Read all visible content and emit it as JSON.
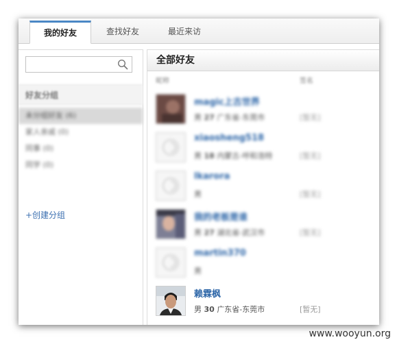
{
  "tabs": [
    {
      "label": "我的好友",
      "active": true
    },
    {
      "label": "查找好友",
      "active": false
    },
    {
      "label": "最近来访",
      "active": false
    }
  ],
  "sidebar": {
    "search": {
      "placeholder": "",
      "value": ""
    },
    "group_header": "好友分组",
    "groups": [
      {
        "label": "未分组好友 (6)"
      },
      {
        "label": "家人亲戚 (0)"
      },
      {
        "label": "同事 (0)"
      },
      {
        "label": "同学 (0)"
      }
    ],
    "create_group": "+创建分组"
  },
  "main": {
    "title": "全部好友",
    "columns": {
      "name": "昵称",
      "status": "签名"
    },
    "friends": [
      {
        "name": "magic上古世界",
        "gender": "男",
        "age": "27",
        "location": "广东省-东莞市",
        "status": "[暂无]",
        "avatar": "photo-dark"
      },
      {
        "name": "xiaosheng518",
        "gender": "男",
        "age": "18",
        "location": "内蒙古-呼和浩特",
        "status": "[暂无]",
        "avatar": "default"
      },
      {
        "name": "lkarora",
        "gender": "男",
        "age": "",
        "location": "",
        "status": "[暂无]",
        "avatar": "default"
      },
      {
        "name": "我的老板是谁",
        "gender": "男",
        "age": "27",
        "location": "湖北省-武汉市",
        "status": "[暂无]",
        "avatar": "photo-face"
      },
      {
        "name": "martin370",
        "gender": "男",
        "age": "",
        "location": "",
        "status": "",
        "avatar": "default"
      },
      {
        "name": "赖霖枫",
        "gender": "男",
        "age": "30",
        "location": "广东省-东莞市",
        "status": "[暂无]",
        "avatar": "photo-man"
      }
    ]
  },
  "watermark": "www.wooyun.org",
  "colors": {
    "accent": "#4a87c5",
    "link": "#2d66a8"
  }
}
